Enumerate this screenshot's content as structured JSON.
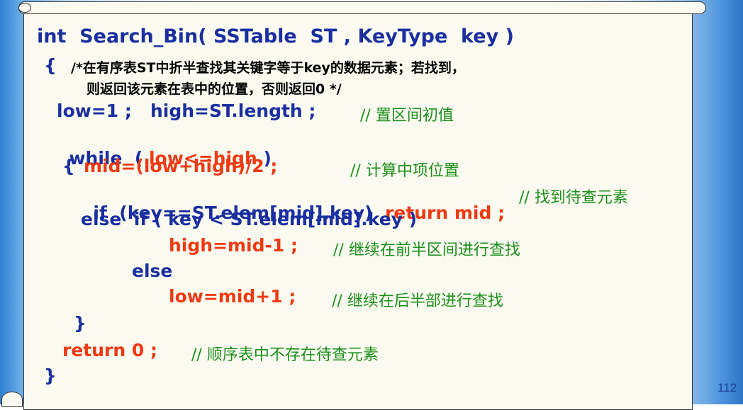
{
  "slide": {
    "page_number": "112"
  },
  "code": {
    "signature": "int  Search_Bin( SSTable  ST , KeyType  key )",
    "open_brace": "{",
    "doc_comment_1": "/*在有序表ST中折半查找其关键字等于key的数据元素；若找到，",
    "doc_comment_2": "则返回该元素在表中的位置，否则返回0 */",
    "init_stmt": "low=1 ;   high=ST.length ;",
    "init_comment": "// 置区间初值",
    "while_kw": "while  (",
    "while_cond": " low<=high",
    "while_close": " )",
    "inner_open": "{",
    "mid_stmt": "mid=(low+high)/2 ;",
    "mid_comment": "// 计算中项位置",
    "if_part": "if  (key==ST.elem[mid].key)",
    "return_mid": "return mid ;",
    "found_comment": "// 找到待查元素",
    "else_if": "else  if ( key < ST.elem[mid].key )",
    "high_stmt": "high=mid-1 ;",
    "high_comment": "// 继续在前半区间进行查找",
    "else_kw": "else",
    "low_stmt": "low=mid+1 ;",
    "low_comment": "// 继续在后半部进行查找",
    "inner_close": "}",
    "return_zero": "return 0 ;",
    "notfound_comment": "// 顺序表中不存在待查元素",
    "close_brace": "}"
  },
  "colors": {
    "keyword_blue": "#1a2fa0",
    "highlight_red": "#ee3a13",
    "comment_green": "#1a8f1a"
  }
}
